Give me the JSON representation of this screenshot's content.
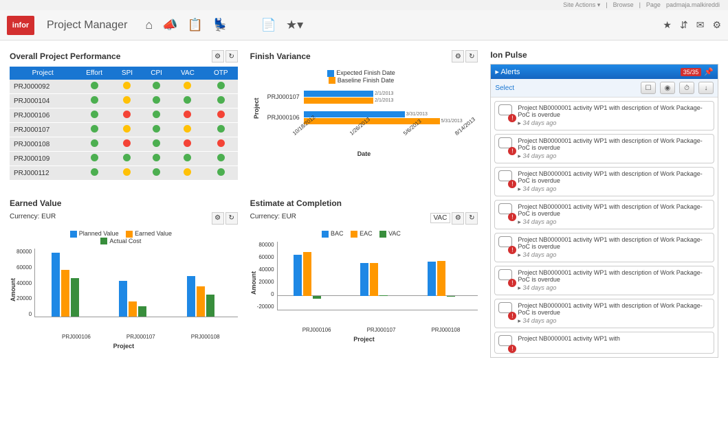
{
  "context": {
    "site_actions": "Site Actions ▾",
    "browse": "Browse",
    "page": "Page",
    "user": "padmaja.malkireddi"
  },
  "header": {
    "logo": "infor",
    "title": "Project Manager"
  },
  "widgets": {
    "performance": {
      "title": "Overall Project Performance",
      "columns": [
        "Project",
        "Effort",
        "SPI",
        "CPI",
        "VAC",
        "OTP"
      ]
    },
    "finish_variance": {
      "title": "Finish Variance",
      "legend1": "Expected Finish Date",
      "legend2": "Baseline Finish Date",
      "ylabel": "Project",
      "xlabel": "Date"
    },
    "ion_pulse": {
      "title": "Ion Pulse",
      "alerts_label": "Alerts",
      "count": "35/35",
      "select": "Select"
    },
    "earned_value": {
      "title": "Earned Value",
      "currency": "Currency: EUR",
      "legend1": "Planned Value",
      "legend2": "Earned Value",
      "legend3": "Actual Cost",
      "ylabel": "Amount",
      "xlabel": "Project"
    },
    "estimate": {
      "title": "Estimate at Completion",
      "currency": "Currency: EUR",
      "dropdown": "VAC",
      "legend1": "BAC",
      "legend2": "EAC",
      "legend3": "VAC",
      "ylabel": "Amount",
      "xlabel": "Project"
    }
  },
  "chart_data": [
    {
      "type": "table",
      "name": "Overall Project Performance",
      "columns": [
        "Project",
        "Effort",
        "SPI",
        "CPI",
        "VAC",
        "OTP"
      ],
      "rows": [
        {
          "project": "PRJ000092",
          "effort": "green",
          "spi": "yellow",
          "cpi": "green",
          "vac": "yellow",
          "otp": "green"
        },
        {
          "project": "PRJ000104",
          "effort": "green",
          "spi": "yellow",
          "cpi": "green",
          "vac": "green",
          "otp": "green"
        },
        {
          "project": "PRJ000106",
          "effort": "green",
          "spi": "red",
          "cpi": "green",
          "vac": "red",
          "otp": "red"
        },
        {
          "project": "PRJ000107",
          "effort": "green",
          "spi": "yellow",
          "cpi": "green",
          "vac": "yellow",
          "otp": "green"
        },
        {
          "project": "PRJ000108",
          "effort": "green",
          "spi": "red",
          "cpi": "green",
          "vac": "red",
          "otp": "red"
        },
        {
          "project": "PRJ000109",
          "effort": "green",
          "spi": "green",
          "cpi": "green",
          "vac": "green",
          "otp": "green"
        },
        {
          "project": "PRJ000112",
          "effort": "green",
          "spi": "yellow",
          "cpi": "green",
          "vac": "yellow",
          "otp": "green"
        }
      ]
    },
    {
      "type": "bar",
      "name": "Finish Variance",
      "orientation": "horizontal",
      "xlabel": "Date",
      "ylabel": "Project",
      "x_ticks": [
        "10/18/2012",
        "1/26/2013",
        "5/6/2013",
        "8/14/2013"
      ],
      "categories": [
        "PRJ000107",
        "PRJ000106"
      ],
      "series": [
        {
          "name": "Expected Finish Date",
          "values": [
            "2/1/2013",
            "3/31/2013"
          ],
          "color": "#1e88e5"
        },
        {
          "name": "Baseline Finish Date",
          "values": [
            "2/1/2013",
            "5/31/2013"
          ],
          "color": "#ff9800"
        }
      ]
    },
    {
      "type": "bar",
      "name": "Earned Value",
      "xlabel": "Project",
      "ylabel": "Amount",
      "ylim": [
        0,
        80000
      ],
      "y_ticks": [
        0,
        20000,
        40000,
        60000,
        80000
      ],
      "categories": [
        "PRJ000106",
        "PRJ000107",
        "PRJ000108"
      ],
      "series": [
        {
          "name": "Planned Value",
          "values": [
            75000,
            42000,
            48000
          ],
          "color": "#1e88e5"
        },
        {
          "name": "Earned Value",
          "values": [
            55000,
            18000,
            36000
          ],
          "color": "#ff9800"
        },
        {
          "name": "Actual Cost",
          "values": [
            45000,
            12000,
            26000
          ],
          "color": "#388e3c"
        }
      ]
    },
    {
      "type": "bar",
      "name": "Estimate at Completion",
      "xlabel": "Project",
      "ylabel": "Amount",
      "ylim": [
        -20000,
        80000
      ],
      "y_ticks": [
        -20000,
        0,
        20000,
        40000,
        60000,
        80000
      ],
      "categories": [
        "PRJ000106",
        "PRJ000107",
        "PRJ000108"
      ],
      "series": [
        {
          "name": "BAC",
          "values": [
            60000,
            48000,
            50000
          ],
          "color": "#1e88e5"
        },
        {
          "name": "EAC",
          "values": [
            64000,
            48000,
            51000
          ],
          "color": "#ff9800"
        },
        {
          "name": "VAC",
          "values": [
            -4000,
            500,
            -1000
          ],
          "color": "#388e3c"
        }
      ]
    }
  ],
  "alerts": [
    {
      "text": "Project NB0000001 activity WP1 with description of Work Package-PoC is overdue",
      "time": "34 days ago"
    },
    {
      "text": "Project NB0000001 activity WP1 with description of Work Package-PoC is overdue",
      "time": "34 days ago"
    },
    {
      "text": "Project NB0000001 activity WP1 with description of Work Package-PoC is overdue",
      "time": "34 days ago"
    },
    {
      "text": "Project NB0000001 activity WP1 with description of Work Package-PoC is overdue",
      "time": "34 days ago"
    },
    {
      "text": "Project NB0000001 activity WP1 with description of Work Package-PoC is overdue",
      "time": "34 days ago"
    },
    {
      "text": "Project NB0000001 activity WP1 with description of Work Package-PoC is overdue",
      "time": "34 days ago"
    },
    {
      "text": "Project NB0000001 activity WP1 with description of Work Package-PoC is overdue",
      "time": "34 days ago"
    },
    {
      "text": "Project NB0000001 activity WP1 with",
      "time": ""
    }
  ],
  "colors": {
    "blue": "#1e88e5",
    "orange": "#ff9800",
    "green": "#388e3c"
  }
}
